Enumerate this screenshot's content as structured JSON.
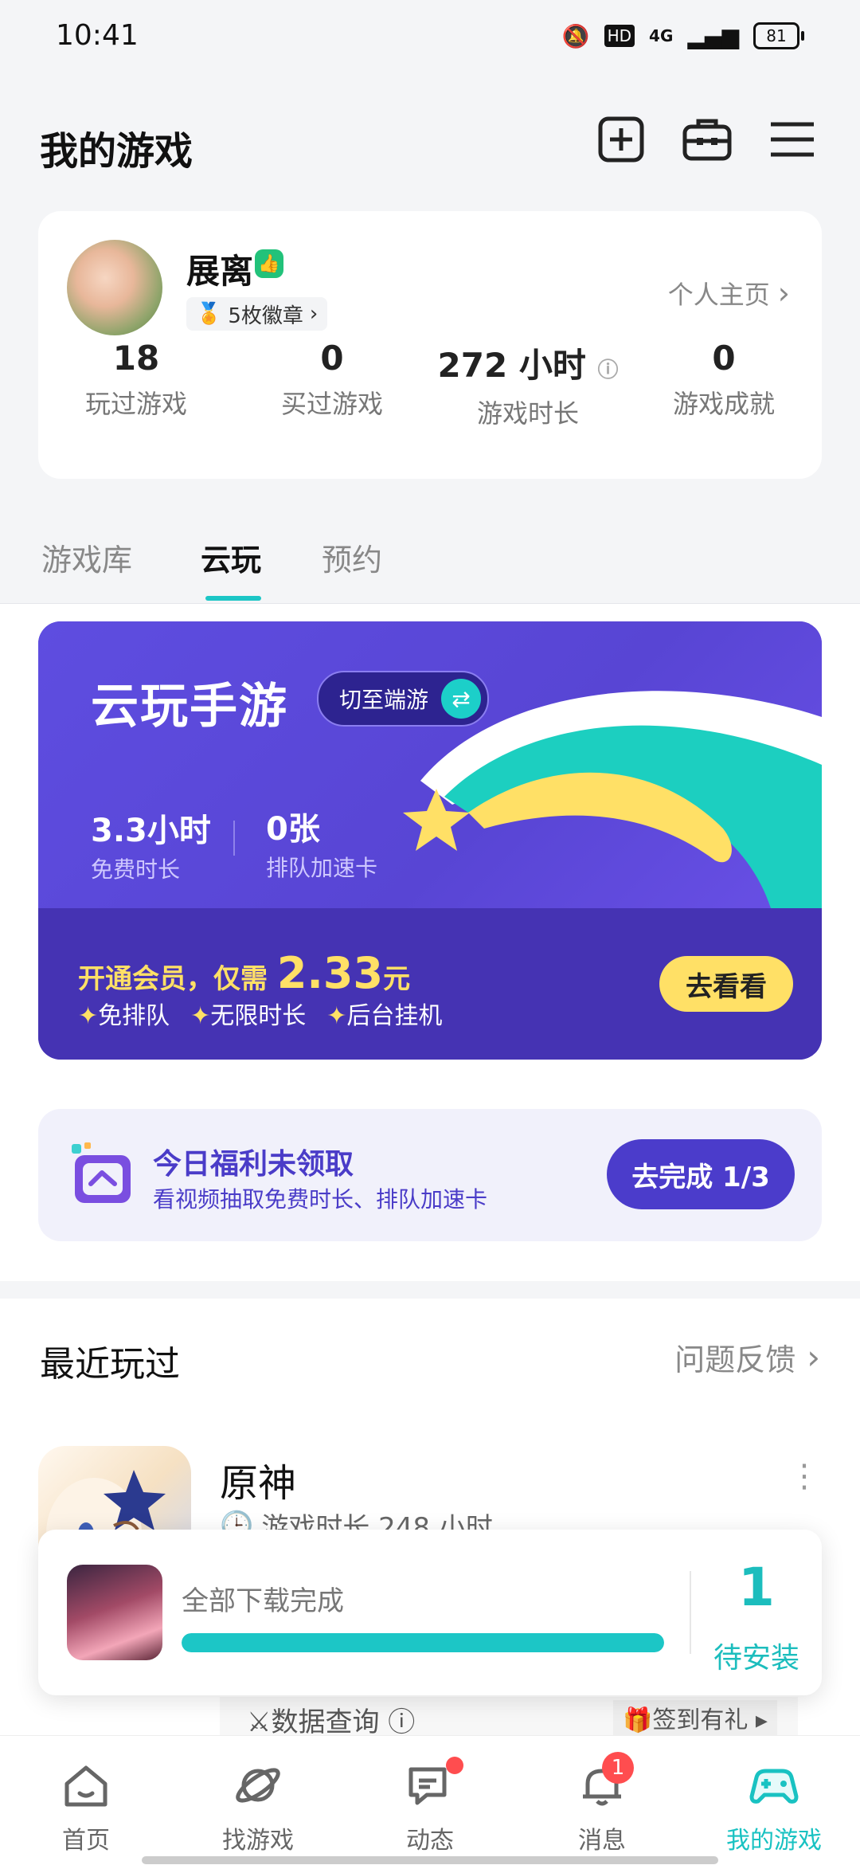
{
  "status": {
    "time": "10:41",
    "network": "4G",
    "battery": "81"
  },
  "header": {
    "title": "我的游戏"
  },
  "profile": {
    "name": "展离",
    "badges": "5枚徽章",
    "home_link": "个人主页",
    "stats": [
      {
        "value": "18",
        "label": "玩过游戏"
      },
      {
        "value": "0",
        "label": "买过游戏"
      },
      {
        "value": "272 小时",
        "label": "游戏时长"
      },
      {
        "value": "0",
        "label": "游戏成就"
      }
    ]
  },
  "tabs": [
    {
      "label": "游戏库"
    },
    {
      "label": "云玩"
    },
    {
      "label": "预约"
    }
  ],
  "banner": {
    "title": "云玩手游",
    "switch_label": "切至端游",
    "stats": [
      {
        "value": "3.3小时",
        "label": "免费时长"
      },
      {
        "value": "0张",
        "label": "排队加速卡"
      }
    ],
    "promo_prefix": "开通会员，仅需",
    "promo_price": "2.33",
    "promo_unit": "元",
    "features": [
      "免排队",
      "无限时长",
      "后台挂机"
    ],
    "cta": "去看看"
  },
  "welfare": {
    "title": "今日福利未领取",
    "subtitle": "看视频抽取免费时长、排队加速卡",
    "button": "去完成 1/3"
  },
  "recent": {
    "title": "最近玩过",
    "feedback": "问题反馈",
    "game": {
      "name": "原神",
      "time": "游戏时长 248 小时"
    }
  },
  "download": {
    "text": "全部下载完成",
    "progress": 1.0,
    "count": "1",
    "count_label": "待安装"
  },
  "strip": {
    "left": "数据查询",
    "right": "签到有礼"
  },
  "nav": [
    {
      "label": "首页"
    },
    {
      "label": "找游戏"
    },
    {
      "label": "动态"
    },
    {
      "label": "消息",
      "badge": "1"
    },
    {
      "label": "我的游戏"
    }
  ],
  "colors": {
    "accent": "#1cc6c6",
    "banner": "#5848d0",
    "welfare": "#4b3ccb"
  }
}
